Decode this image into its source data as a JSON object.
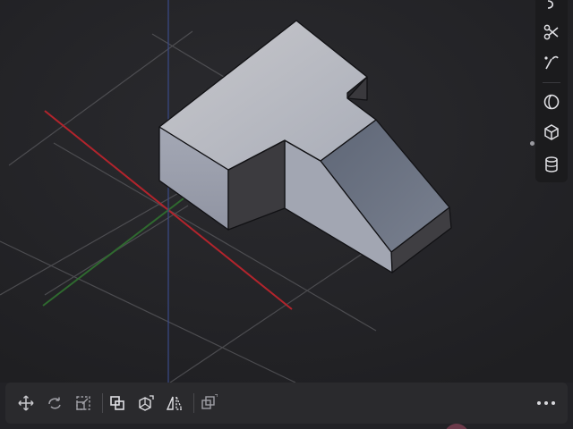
{
  "app": {
    "background": "#222226"
  },
  "viewport": {
    "axis_colors": {
      "x": "#b3242c",
      "y": "#2f6a2f",
      "z": "#3a4a88"
    },
    "grid_color": "#5a5a5e",
    "model": {
      "face_top": "#b9bcc4",
      "face_front": "#9fa4b1",
      "face_side": "#3e3e42",
      "face_slope": "#6c7482",
      "edge": "#111114"
    }
  },
  "right_toolbar": {
    "tools": [
      {
        "name": "undo",
        "icon": "undo-icon"
      },
      {
        "name": "cut",
        "icon": "scissors-icon"
      },
      {
        "name": "trim",
        "icon": "trim-curve-icon"
      },
      {
        "name": "revolve",
        "icon": "revolve-icon"
      },
      {
        "name": "box",
        "icon": "cube-icon"
      },
      {
        "name": "cylinder",
        "icon": "cylinder-icon"
      }
    ]
  },
  "bottom_toolbar": {
    "tools": [
      {
        "name": "move",
        "icon": "move-arrows-icon"
      },
      {
        "name": "rotate",
        "icon": "rotate-icon"
      },
      {
        "name": "scale",
        "icon": "scale-icon"
      },
      {
        "name": "boolean-union",
        "icon": "boolean-icon"
      },
      {
        "name": "extrude",
        "icon": "extrude-icon"
      },
      {
        "name": "mirror",
        "icon": "mirror-icon"
      },
      {
        "name": "duplicate",
        "icon": "duplicate-icon"
      }
    ],
    "more_icon": "more-horizontal-icon"
  }
}
